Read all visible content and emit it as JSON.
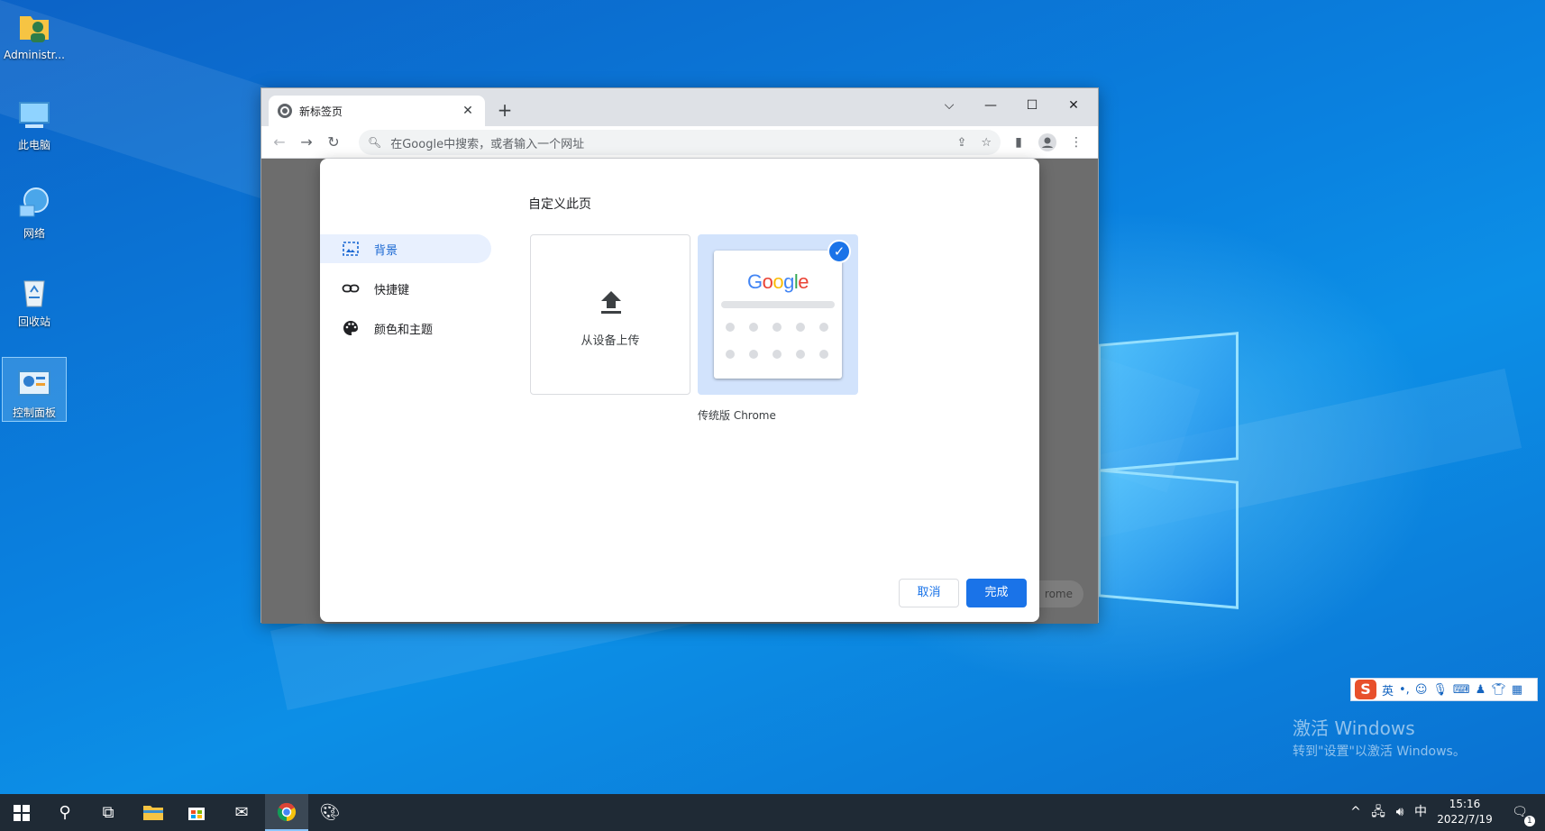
{
  "desktop": {
    "icons": [
      {
        "label": "Administr..."
      },
      {
        "label": "此电脑"
      },
      {
        "label": "网络"
      },
      {
        "label": "回收站"
      },
      {
        "label": "控制面板"
      }
    ]
  },
  "browser": {
    "tab_title": "新标签页",
    "omnibox_placeholder": "在Google中搜索，或者输入一个网址",
    "background_button_partial": "rome"
  },
  "dialog": {
    "title": "自定义此页",
    "sidebar": [
      {
        "label": "背景",
        "active": true
      },
      {
        "label": "快捷键",
        "active": false
      },
      {
        "label": "颜色和主题",
        "active": false
      }
    ],
    "upload_label": "从设备上传",
    "classic_label": "传统版 Chrome",
    "google_logo": [
      "G",
      "o",
      "o",
      "g",
      "l",
      "e"
    ],
    "cancel_label": "取消",
    "done_label": "完成"
  },
  "activation": {
    "line1": "激活 Windows",
    "line2": "转到\"设置\"以激活 Windows。"
  },
  "ime": {
    "mode": "英",
    "punct": "•,"
  },
  "taskbar": {
    "ime_indicator": "中",
    "time": "15:16",
    "date": "2022/7/19",
    "notification_count": "1"
  },
  "colors": {
    "accent": "#1a73e8",
    "google_blue": "#4285f4",
    "google_red": "#ea4335",
    "google_yellow": "#fbbc05",
    "google_green": "#34a853"
  }
}
